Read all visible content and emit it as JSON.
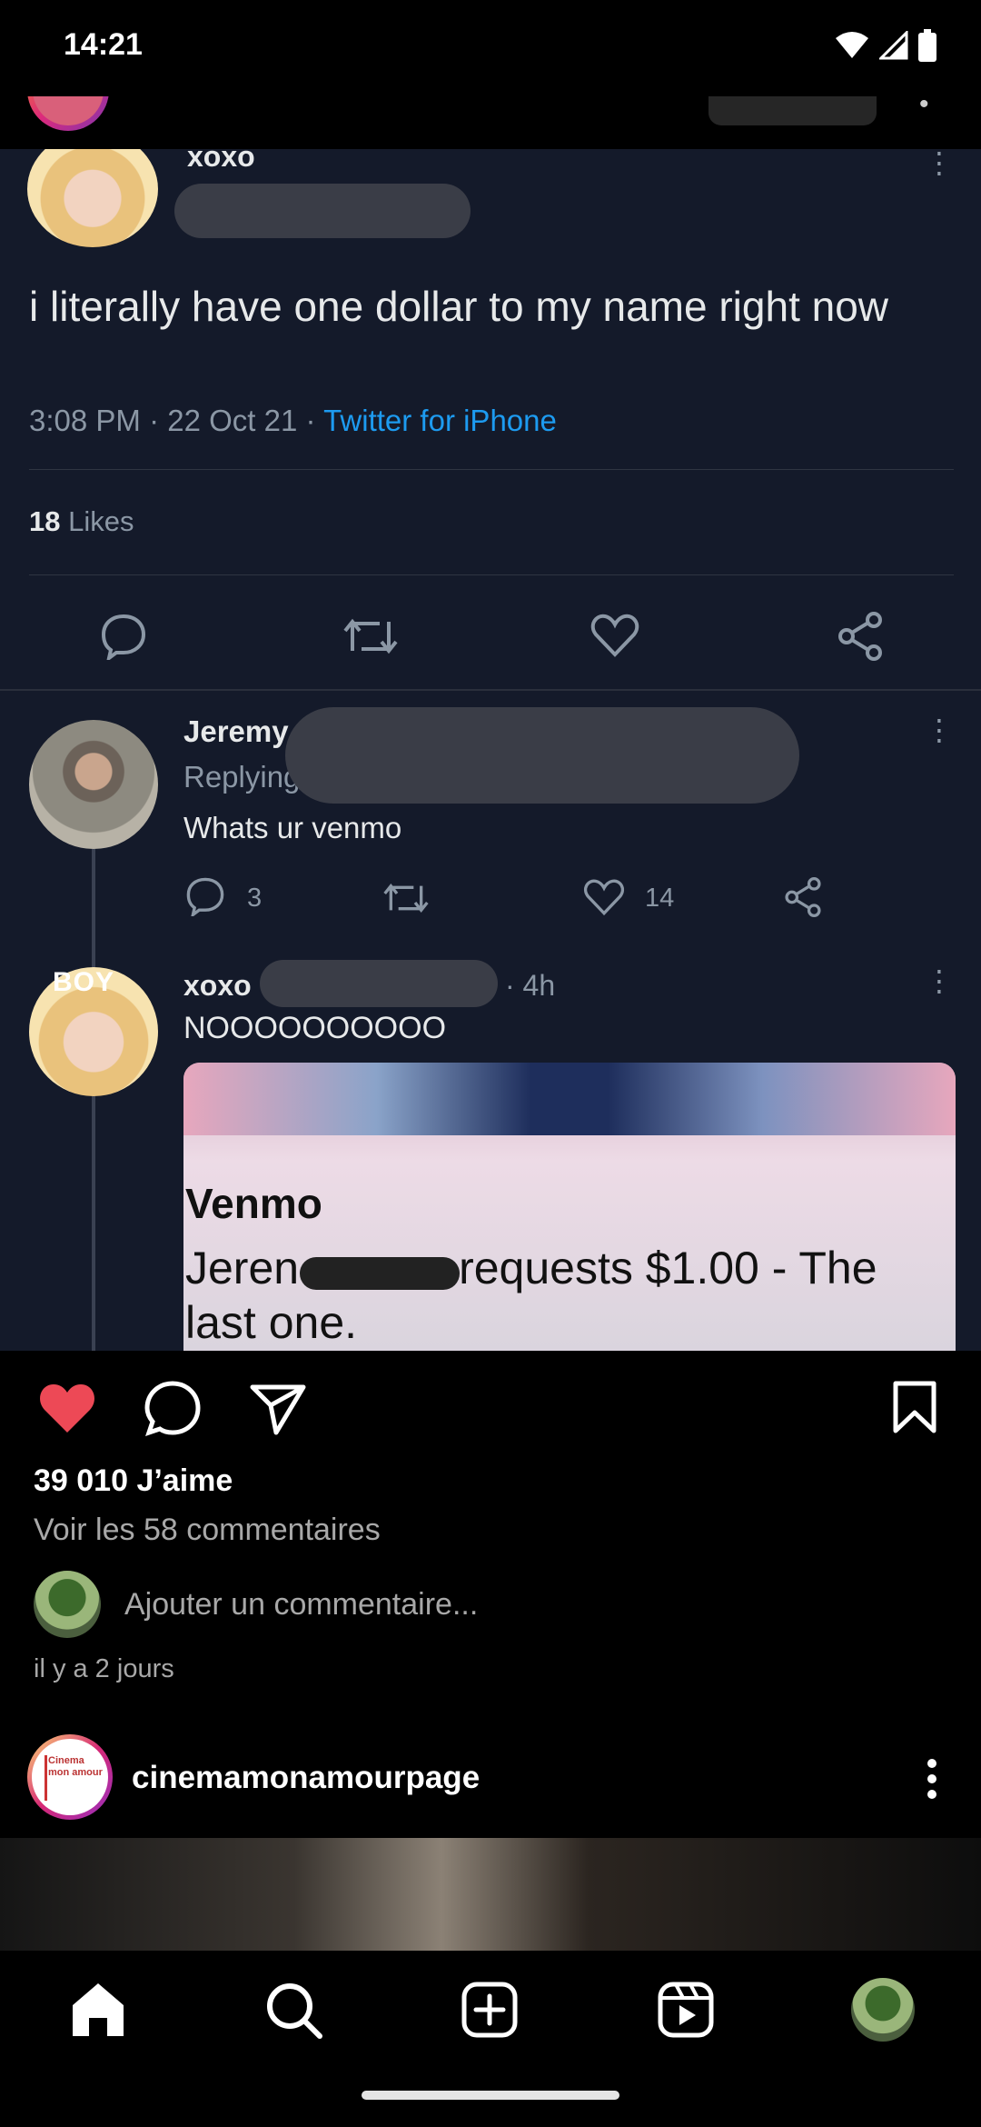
{
  "status_bar": {
    "time": "14:21",
    "icons": [
      "wifi-icon",
      "cell-signal-icon",
      "battery-icon"
    ]
  },
  "post": {
    "image_content": {
      "tweet": {
        "username": "xoxo",
        "text": "i literally have one dollar to my name right now",
        "time": "3:08 PM",
        "date": "22 Oct 21",
        "source": "Twitter for iPhone",
        "likes_count": "18",
        "likes_label": "Likes"
      },
      "reply1": {
        "name": "Jeremy",
        "replying_prefix": "Replying",
        "text": "Whats ur venmo",
        "comments": "3",
        "likes": "14"
      },
      "reply2": {
        "username": "xoxo",
        "time": "· 4h",
        "text": "NOOOOOOOOOO",
        "avatar_badge": "BOY"
      },
      "venmo": {
        "title": "Venmo",
        "body_start": "Jeren",
        "body_end": "requests $1.00 - The last one."
      }
    },
    "likes_text": "39 010 J’aime",
    "view_comments": "Voir les 58 commentaires",
    "comment_placeholder": "Ajouter un commentaire...",
    "time_ago": "il y a 2 jours",
    "like_color": "#ed4956"
  },
  "next_post": {
    "username": "cinemamonamourpage",
    "logo_text": "Cinema mon amour"
  },
  "bottom_nav": {
    "items": [
      "home-icon",
      "search-icon",
      "create-icon",
      "reels-icon",
      "profile-avatar"
    ]
  }
}
